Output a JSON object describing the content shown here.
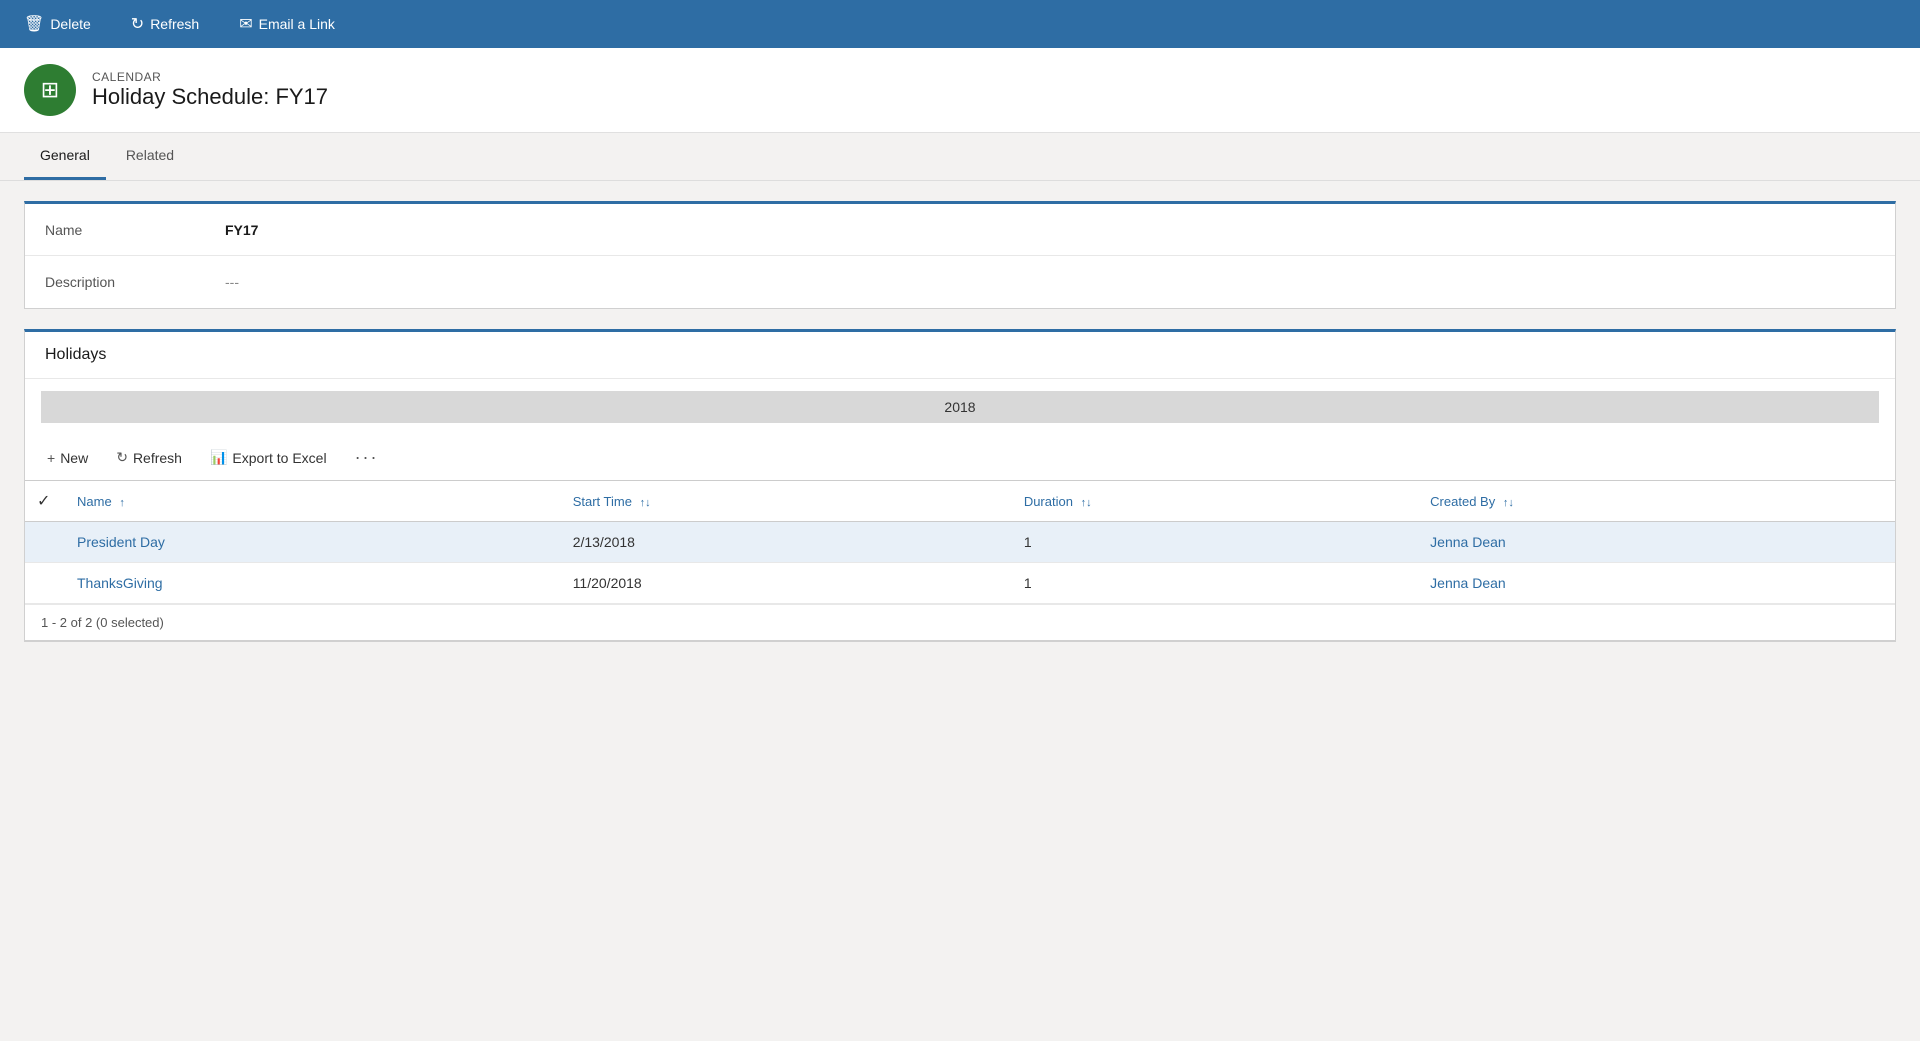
{
  "toolbar": {
    "delete_label": "Delete",
    "refresh_label": "Refresh",
    "email_link_label": "Email a Link"
  },
  "header": {
    "record_type": "CALENDAR",
    "record_title": "Holiday Schedule: FY17",
    "icon_symbol": "📅"
  },
  "tabs": [
    {
      "id": "general",
      "label": "General",
      "active": true
    },
    {
      "id": "related",
      "label": "Related",
      "active": false
    }
  ],
  "form": {
    "name_label": "Name",
    "name_value": "FY17",
    "description_label": "Description",
    "description_value": "---"
  },
  "holidays": {
    "section_title": "Holidays",
    "year_banner": "2018",
    "toolbar": {
      "new_label": "New",
      "refresh_label": "Refresh",
      "export_label": "Export to Excel"
    },
    "table": {
      "columns": [
        {
          "id": "name",
          "label": "Name",
          "sortable": true
        },
        {
          "id": "start_time",
          "label": "Start Time",
          "sortable": true
        },
        {
          "id": "duration",
          "label": "Duration",
          "sortable": true
        },
        {
          "id": "created_by",
          "label": "Created By",
          "sortable": true
        }
      ],
      "rows": [
        {
          "name": "President Day",
          "start_time": "2/13/2018",
          "duration": "1",
          "created_by": "Jenna Dean",
          "highlighted": true
        },
        {
          "name": "ThanksGiving",
          "start_time": "11/20/2018",
          "duration": "1",
          "created_by": "Jenna Dean",
          "highlighted": false
        }
      ]
    },
    "pagination": "1 - 2 of 2 (0 selected)"
  }
}
